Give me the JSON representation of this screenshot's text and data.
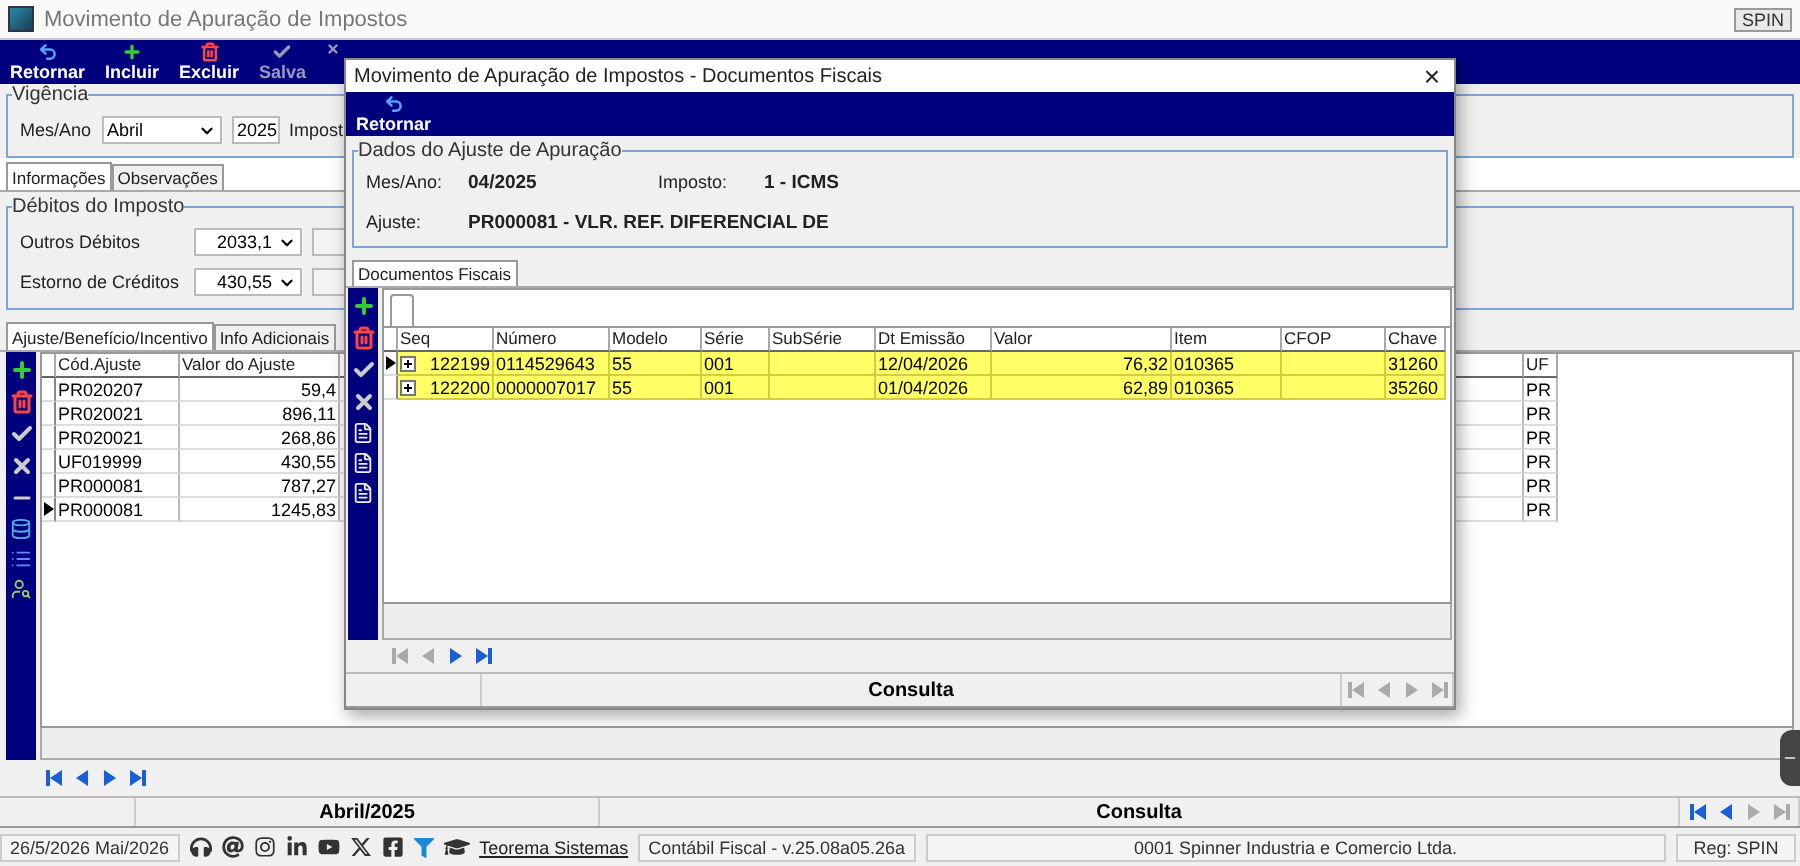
{
  "window": {
    "title": "Movimento de Apuração de Impostos",
    "corner_label": "SPIN"
  },
  "toolbar": [
    {
      "kind": "return",
      "label": "Retornar",
      "disabled": false
    },
    {
      "kind": "add",
      "label": "Incluir",
      "disabled": false
    },
    {
      "kind": "delete",
      "label": "Excluir",
      "disabled": false
    },
    {
      "kind": "save",
      "label": "Salva",
      "disabled": true
    },
    {
      "kind": "cancel",
      "disabled": true
    }
  ],
  "vigencia": {
    "title": "Vigência",
    "month_label": "Mes/Ano",
    "month": "Abril",
    "year": "2025",
    "tax_label": "Impost"
  },
  "tabs": [
    {
      "label": "Informações",
      "selected": true
    },
    {
      "label": "Observações",
      "selected": false
    }
  ],
  "debitos": {
    "title": "Débitos do Imposto",
    "fields": [
      {
        "label": "Outros Débitos",
        "value": "2033,1"
      },
      {
        "label": "Estorno de Créditos",
        "value": "430,55"
      }
    ]
  },
  "detail_tabs": [
    {
      "label": "Ajuste/Benefício/Incentivo",
      "selected": true
    },
    {
      "label": "Info Adicionais",
      "selected": false
    }
  ],
  "adjust_table": {
    "columns": [
      "Cód.Ajuste",
      "Valor do Ajuste"
    ],
    "uf_column": "UF",
    "rows": [
      {
        "code": "PR020207",
        "value": "59,4",
        "uf": "PR",
        "current": false
      },
      {
        "code": "PR020021",
        "value": "896,11",
        "uf": "PR",
        "current": false
      },
      {
        "code": "PR020021",
        "value": "268,86",
        "uf": "PR",
        "current": false
      },
      {
        "code": "UF019999",
        "value": "430,55",
        "uf": "PR",
        "current": false
      },
      {
        "code": "PR000081",
        "value": "787,27",
        "uf": "PR",
        "current": false
      },
      {
        "code": "PR000081",
        "value": "1245,83",
        "uf": "PR",
        "current": true
      }
    ]
  },
  "nav": [
    {
      "disabled": false
    },
    {
      "disabled": false
    },
    {
      "disabled": false
    },
    {
      "disabled": false
    }
  ],
  "status": {
    "period": "Abril/2025",
    "mode": "Consulta",
    "nav": [
      {
        "disabled": false
      },
      {
        "disabled": false
      },
      {
        "disabled": true
      },
      {
        "disabled": true
      }
    ]
  },
  "footer": {
    "date": "26/5/2026 Mai/2026",
    "link": "Teorema Sistemas",
    "version": "Contábil Fiscal - v.25.08a05.26a",
    "company": "0001 Spinner Industria e Comercio Ltda.",
    "user": "Reg: SPIN"
  },
  "dialog": {
    "title": "Movimento de Apuração de Impostos - Documentos Fiscais",
    "close": "×",
    "toolbar": [
      {
        "kind": "return",
        "label": "Retornar"
      }
    ],
    "group": {
      "title": "Dados do Ajuste de Apuração",
      "month_label": "Mes/Ano:",
      "month": "04/2025",
      "tax_label": "Imposto:",
      "tax": "1 - ICMS",
      "adjust_label": "Ajuste:",
      "adjust": "PR000081 - VLR. REF. DIFERENCIAL DE"
    },
    "tabs": [
      {
        "label": "Documentos Fiscais",
        "selected": true
      }
    ],
    "table": {
      "columns": [
        "Seq",
        "Número",
        "Modelo",
        "Série",
        "SubSérie",
        "Dt Emissão",
        "Valor",
        "Item",
        "CFOP",
        "Chave"
      ],
      "rows": [
        {
          "current": true,
          "cells": [
            "122199",
            "0114529643",
            "55",
            "001",
            "",
            "12/04/2026",
            "76,32",
            "010365",
            "",
            "31260"
          ]
        },
        {
          "current": false,
          "cells": [
            "122200",
            "0000007017",
            "55",
            "001",
            "",
            "01/04/2026",
            "62,89",
            "010365",
            "",
            "35260"
          ]
        }
      ]
    },
    "nav": [
      {
        "disabled": true
      },
      {
        "disabled": true
      },
      {
        "disabled": false
      },
      {
        "disabled": false
      }
    ],
    "status": "Consulta"
  }
}
